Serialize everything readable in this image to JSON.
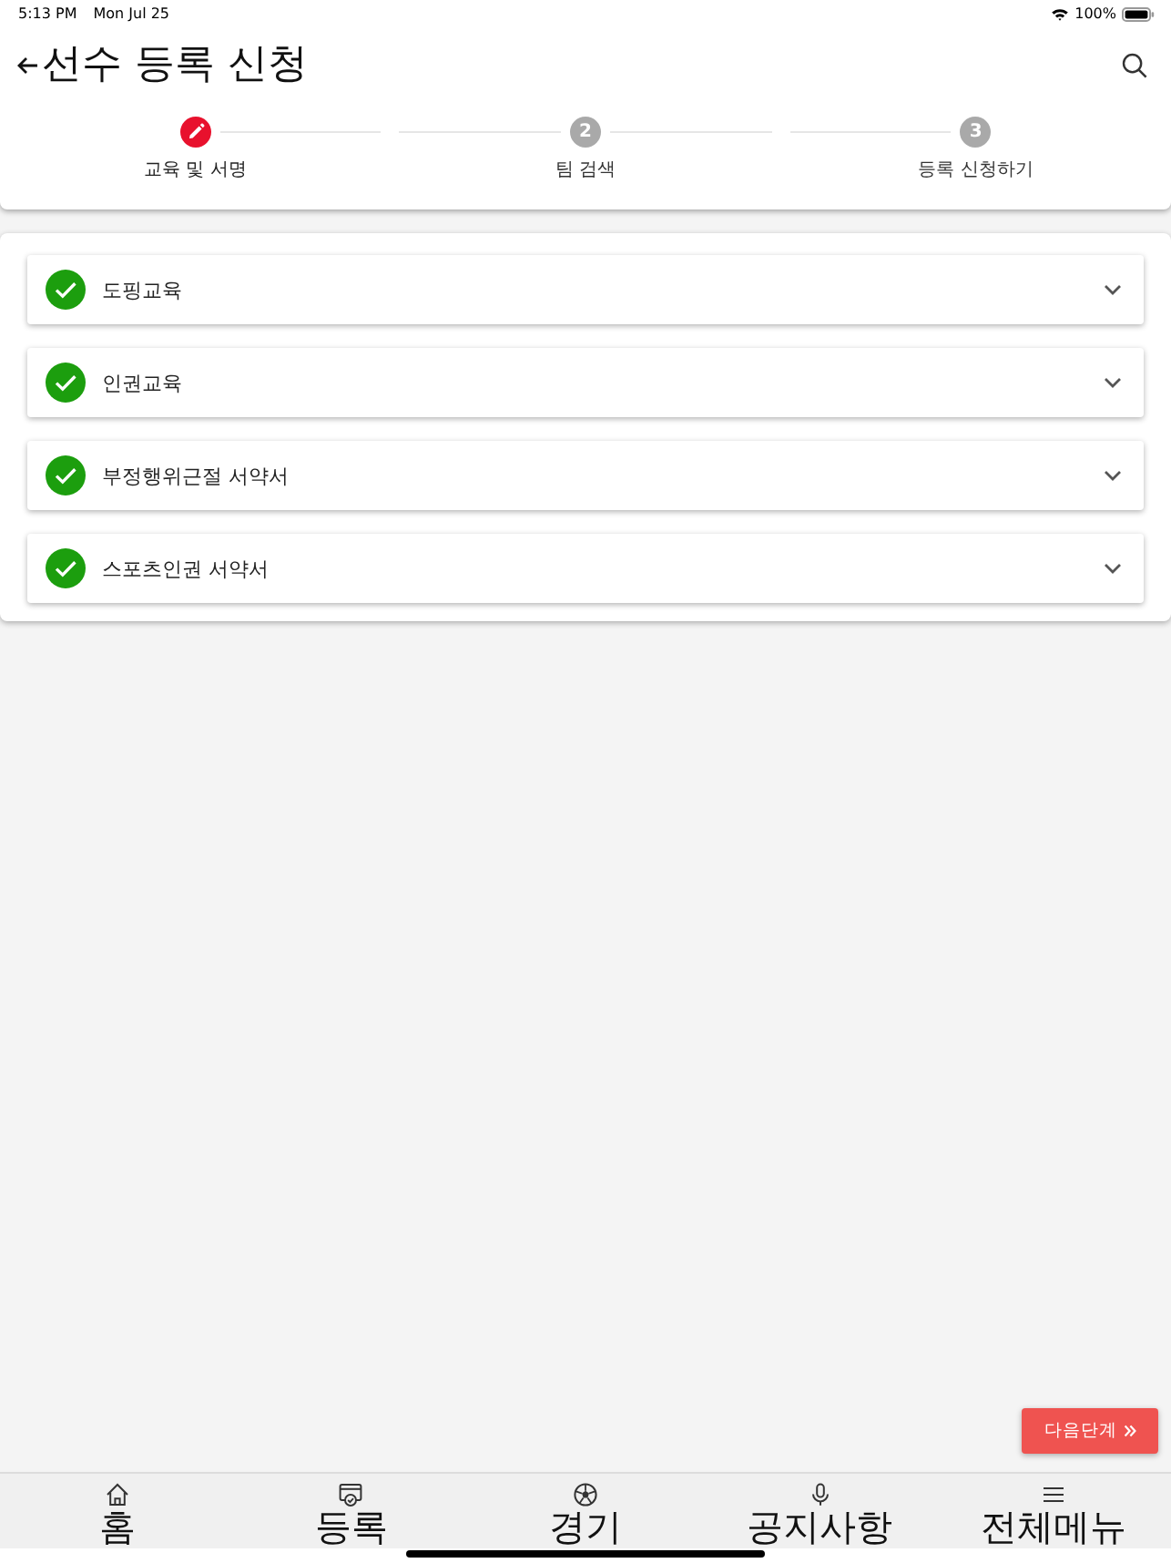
{
  "status_bar": {
    "time": "5:13 PM",
    "date": "Mon Jul 25",
    "battery": "100%"
  },
  "header": {
    "title": "선수 등록 신청"
  },
  "steps": [
    {
      "label": "교육 및 서명",
      "selected": true
    },
    {
      "label": "팀 검색",
      "number": "2",
      "selected": false
    },
    {
      "label": "등록 신청하기",
      "number": "3",
      "selected": false
    }
  ],
  "sections": [
    {
      "title": "도핑교육",
      "checked": true,
      "expanded": false
    },
    {
      "title": "인권교육",
      "checked": true,
      "expanded": false
    },
    {
      "title": "부정행위근절 서약서",
      "checked": true,
      "expanded": false
    },
    {
      "title": "스포츠인권 서약서",
      "checked": true,
      "expanded": false
    }
  ],
  "next_button": {
    "label": "다음단계"
  },
  "bottom_nav": [
    {
      "label": "홈"
    },
    {
      "label": "등록"
    },
    {
      "label": "경기"
    },
    {
      "label": "공지사항"
    },
    {
      "label": "전체메뉴"
    }
  ]
}
